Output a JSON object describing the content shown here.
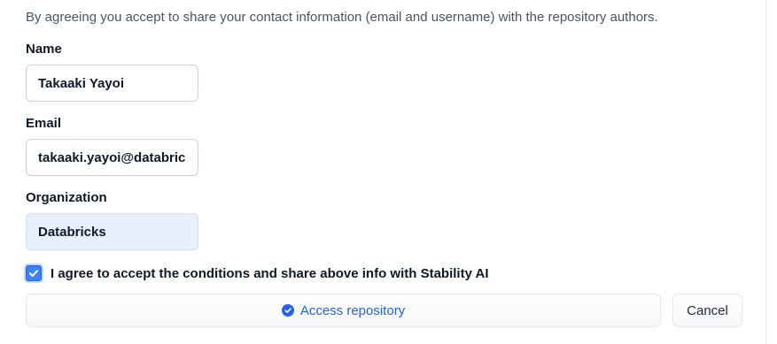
{
  "notice": "By agreeing you accept to share your contact information (email and username) with the repository authors.",
  "form": {
    "name": {
      "label": "Name",
      "value": "Takaaki Yayoi"
    },
    "email": {
      "label": "Email",
      "value": "takaaki.yayoi@databricks.com"
    },
    "organization": {
      "label": "Organization",
      "value": "Databricks"
    }
  },
  "agree": {
    "checked": true,
    "label": "I agree to accept the conditions and share above info with Stability AI"
  },
  "buttons": {
    "access": {
      "label": "Access repository",
      "icon": "check-circle-icon"
    },
    "cancel": {
      "label": "Cancel"
    }
  },
  "colors": {
    "accent": "#2563eb",
    "checkbox": "#3b82f6",
    "autofill_bg": "#e8f0fe"
  }
}
